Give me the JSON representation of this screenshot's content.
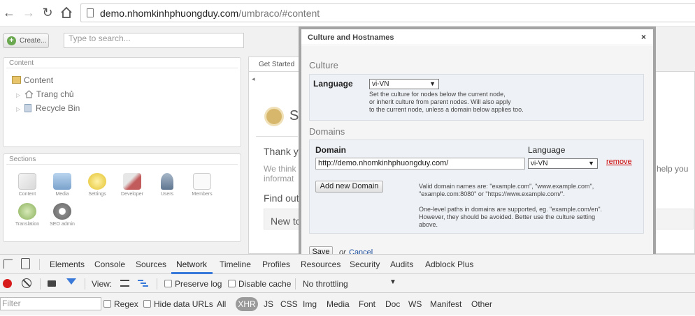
{
  "browser": {
    "url_host": "demo.nhomkinhphuongduy.com",
    "url_path": "/umbraco/#content"
  },
  "backoffice": {
    "create_label": "Create...",
    "search_placeholder": "Type to search...",
    "content_panel_title": "Content",
    "tree": [
      {
        "label": "Content"
      },
      {
        "label": "Trang chủ"
      },
      {
        "label": "Recycle Bin"
      }
    ],
    "sections_panel_title": "Sections",
    "sections": [
      {
        "label": "Content"
      },
      {
        "label": "Media"
      },
      {
        "label": "Settings"
      },
      {
        "label": "Developer"
      },
      {
        "label": "Users"
      },
      {
        "label": "Members"
      },
      {
        "label": "Translation"
      },
      {
        "label": "SEO admin"
      }
    ],
    "getting_started_tab": "Get Started",
    "bg_fragments": {
      "s": "S",
      "thank": "Thank y",
      "we_think": "We think",
      "inform": "informat",
      "find": "Find out",
      "new": "New to",
      "help": "help you"
    }
  },
  "modal": {
    "title": "Culture and Hostnames",
    "close": "×",
    "culture_heading": "Culture",
    "language_label": "Language",
    "language_value": "vi-VN",
    "culture_hint_1": "Set the culture for nodes below the current node,",
    "culture_hint_2": "or inherit culture from parent nodes. Will also apply",
    "culture_hint_3": "to the current node, unless a domain below applies too.",
    "domains_heading": "Domains",
    "domain_col": "Domain",
    "language_col": "Language",
    "domain_value": "http://demo.nhomkinhphuongduy.com/",
    "domain_language": "vi-VN",
    "remove_label": "remove",
    "add_domain_label": "Add new Domain",
    "domain_hint_1": "Valid domain names are: \"example.com\", \"www.example.com\",",
    "domain_hint_2": "\"example.com:8080\" or \"https://www.example.com/\".",
    "domain_hint_3": "One-level paths in domains are supported, eg. \"example.com/en\".",
    "domain_hint_4": "However, they should be avoided. Better use the culture setting",
    "domain_hint_5": "above.",
    "save_label": "Save",
    "or_label": "or",
    "cancel_label": "Cancel"
  },
  "devtools": {
    "tabs": [
      "Elements",
      "Console",
      "Sources",
      "Network",
      "Timeline",
      "Profiles",
      "Resources",
      "Security",
      "Audits",
      "Adblock Plus"
    ],
    "active_tab": "Network",
    "view_label": "View:",
    "preserve_log": "Preserve log",
    "disable_cache": "Disable cache",
    "throttling": "No throttling",
    "filter_placeholder": "Filter",
    "regex": "Regex",
    "hide_data_urls": "Hide data URLs",
    "all": "All",
    "types": [
      "XHR",
      "JS",
      "CSS",
      "Img",
      "Media",
      "Font",
      "Doc",
      "WS",
      "Manifest",
      "Other"
    ],
    "colors": {
      "record": "#d81b1b",
      "accent": "#3879d9"
    }
  }
}
